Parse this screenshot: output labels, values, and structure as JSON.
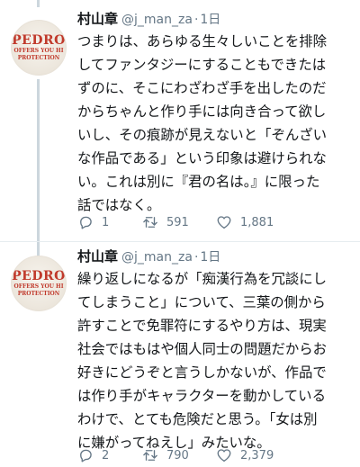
{
  "tweets": [
    {
      "avatar": {
        "line1": "PEDRO",
        "line2": "OFFERS YOU HI",
        "line3": "PROTECTION"
      },
      "name": "村山章",
      "handle": "@j_man_za",
      "separator": "·",
      "time": "1日",
      "text": "つまりは、あらゆる生々しいことを排除\nしてファンタジーにすることもできたは\nずのに、そこにわざわざ手を出したのだ\nからちゃんと作り手には向き合って欲し\nいし、その痕跡が見えないと「ぞんざい\nな作品である」という印象は避けられな\nい。これは別に『君の名は。』に限った\n話ではなく。",
      "reply_count": "1",
      "retweet_count": "591",
      "like_count": "1,881"
    },
    {
      "avatar": {
        "line1": "PEDRO",
        "line2": "OFFERS YOU HI",
        "line3": "PROTECTION"
      },
      "name": "村山章",
      "handle": "@j_man_za",
      "separator": "·",
      "time": "1日",
      "text": "繰り返しになるが「痴漢行為を冗談にし\nてしまうこと」について、三葉の側から\n許すことで免罪符にするやり方は、現実\n社会ではもはや個人同士の問題だからお\n好きにどうぞと言うしかないが、作品で\nは作り手がキャラクターを動かしている\nわけで、とても危険だと思う。「女は別\nに嫌がってねえし」みたいな。",
      "reply_count": "2",
      "retweet_count": "790",
      "like_count": "2,379"
    }
  ],
  "icons": [
    "reply-icon",
    "retweet-icon",
    "like-icon"
  ],
  "colors": {
    "text": "#14171a",
    "secondary": "#657786",
    "thread": "#ccd6dd",
    "avatar_text": "#c0392b"
  }
}
